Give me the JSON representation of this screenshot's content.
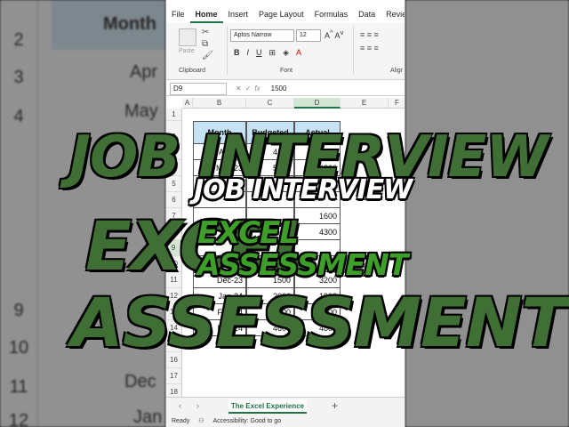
{
  "background": {
    "left_header": "Month",
    "left_rows": [
      {
        "num": "2",
        "text": ""
      },
      {
        "num": "3",
        "text": "Apr"
      },
      {
        "num": "4",
        "text": "May"
      },
      {
        "num": "9",
        "text": ""
      },
      {
        "num": "10",
        "text": ""
      },
      {
        "num": "11",
        "text": "Dec"
      },
      {
        "num": "12",
        "text": "Jan"
      }
    ]
  },
  "menu": {
    "items": [
      "File",
      "Home",
      "Insert",
      "Page Layout",
      "Formulas",
      "Data",
      "Review"
    ],
    "active": "Home"
  },
  "ribbon": {
    "paste_label": "Paste",
    "clipboard_label": "Clipboard",
    "font_name": "Aptos Narrow",
    "font_size": "12",
    "font_group_label": "Font",
    "align_group_label": "Aligr",
    "bold": "B",
    "italic": "I",
    "underline": "U"
  },
  "formula_bar": {
    "name_box": "D9",
    "fx": "fx",
    "value": "1500"
  },
  "grid": {
    "columns": [
      "A",
      "B",
      "C",
      "D",
      "E",
      "F"
    ],
    "selected_column": "D",
    "row_numbers": [
      "1",
      "2",
      "3",
      "4",
      "5",
      "6",
      "7",
      "8",
      "9",
      "10",
      "11",
      "12",
      "13",
      "14",
      "15",
      "16",
      "17",
      "18"
    ],
    "selected_row": "9",
    "table_headers": [
      "Month",
      "Budgeted",
      "Actual"
    ],
    "table_rows": [
      {
        "month": "Apr-23",
        "budgeted": "4100",
        "actual": "3100"
      },
      {
        "month": "May-23",
        "budgeted": "5000",
        "actual": "4800"
      },
      {
        "month": "",
        "budgeted": "",
        "actual": ""
      },
      {
        "month": "",
        "budgeted": "",
        "actual": ""
      },
      {
        "month": "",
        "budgeted": "",
        "actual": "1600"
      },
      {
        "month": "",
        "budgeted": "",
        "actual": "4300"
      },
      {
        "month": "",
        "budgeted": "",
        "actual": ""
      },
      {
        "month": "",
        "budgeted": "",
        "actual": ""
      },
      {
        "month": "Dec-23",
        "budgeted": "1500",
        "actual": "3200"
      },
      {
        "month": "Jan-24",
        "budgeted": "2000",
        "actual": "1900"
      },
      {
        "month": "Feb-24",
        "budgeted": "4400",
        "actual": "2300"
      },
      {
        "month": "Mar-24",
        "budgeted": "4600",
        "actual": "4800"
      }
    ]
  },
  "sheet_tabs": {
    "active": "The Excel Experience",
    "add": "+"
  },
  "status_bar": {
    "ready": "Ready",
    "accessibility": "Accessibility: Good to go"
  },
  "overlay": {
    "line1": "JOB INTERVIEW",
    "line2": "EXCEL",
    "line3": "ASSESSMENT",
    "big_bg_1": "JOB INTERVIEW",
    "big_bg_2": "EXCEL",
    "big_bg_3": "ASSESSMENT"
  },
  "colors": {
    "excel_green": "#217346",
    "header_fill": "#c5e3f5",
    "overlay_green": "#3e9e2a"
  }
}
